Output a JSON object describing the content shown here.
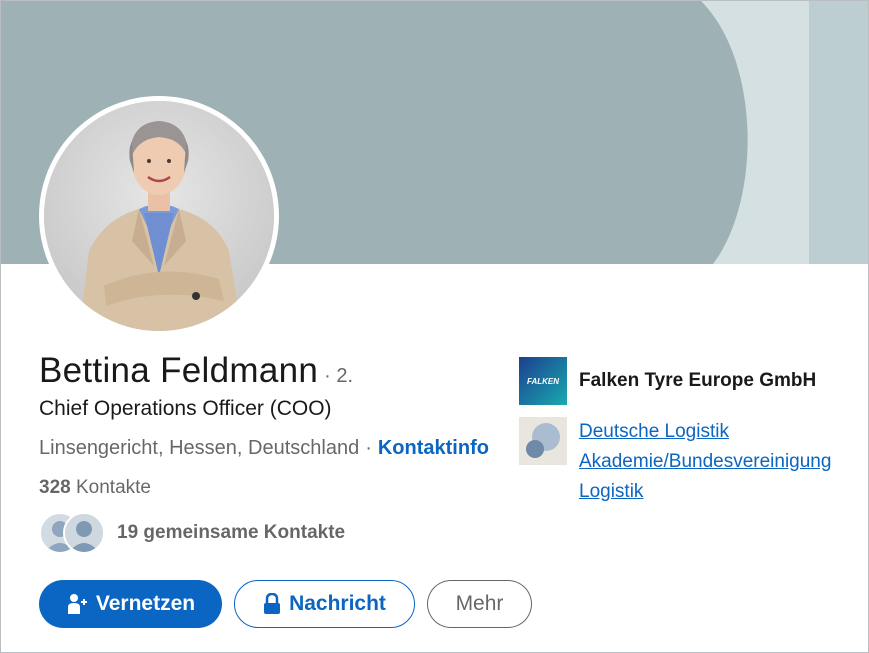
{
  "profile": {
    "name": "Bettina Feldmann",
    "degree": "· 2.",
    "headline": "Chief Operations Officer (COO)",
    "location": "Linsengericht, Hessen, Deutschland",
    "separator": "·",
    "contact_info_label": "Kontaktinfo",
    "connections_count": "328",
    "connections_label": "Kontakte",
    "mutual_label": "19 gemeinsame Kontakte"
  },
  "actions": {
    "connect_label": "Vernetzen",
    "message_label": "Nachricht",
    "more_label": "Mehr"
  },
  "organizations": [
    {
      "name": "Falken Tyre Europe GmbH",
      "logo_text": "FALKEN",
      "link": false
    },
    {
      "name_lines": [
        "Deutsche Logistik",
        "Akademie/Bundesvereinigung",
        "Logistik"
      ],
      "link": true
    }
  ],
  "colors": {
    "accent": "#0a66c2",
    "banner": "#9eb1b4"
  },
  "icons": {
    "connect": "add-person-icon",
    "message": "lock-icon"
  }
}
